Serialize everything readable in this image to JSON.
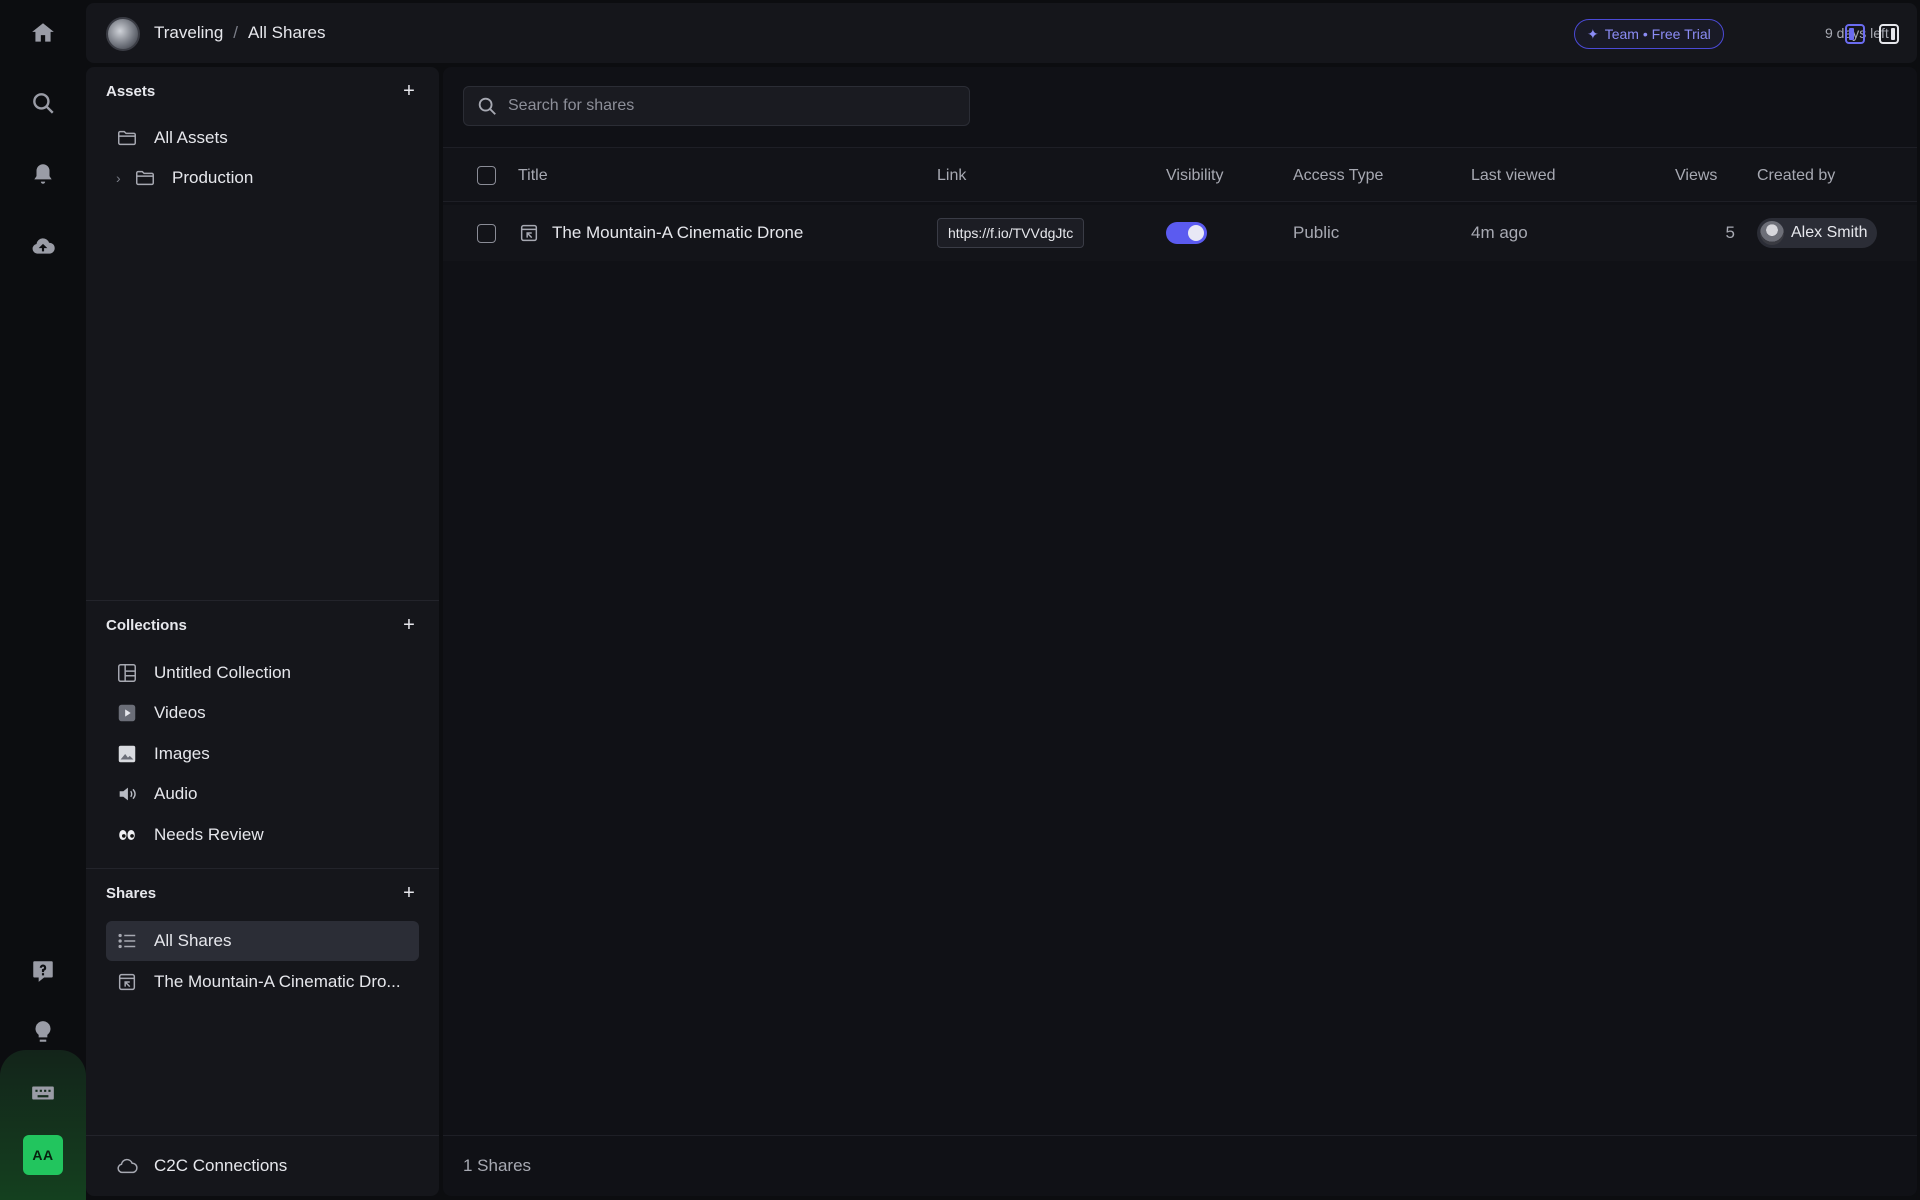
{
  "breadcrumbs": [
    "Traveling",
    "All Shares"
  ],
  "breadcrumb_separator": "/",
  "trial": {
    "label": "Team • Free Trial",
    "days_left": "9 days left"
  },
  "rail": {
    "avatar_initials": "AA",
    "icons": [
      "home-icon",
      "search-icon",
      "bell-icon",
      "upload-cloud-icon",
      "help-icon",
      "lightbulb-icon",
      "keyboard-icon"
    ]
  },
  "assets": {
    "title": "Assets",
    "items": [
      {
        "label": "All Assets",
        "icon": "folder-icon"
      },
      {
        "label": "Production",
        "icon": "folder-icon",
        "expandable": true
      }
    ]
  },
  "collections": {
    "title": "Collections",
    "items": [
      {
        "label": "Untitled Collection",
        "icon": "layout-grid-icon"
      },
      {
        "label": "Videos",
        "icon": "play-icon"
      },
      {
        "label": "Images",
        "icon": "image-icon"
      },
      {
        "label": "Audio",
        "icon": "speaker-icon"
      },
      {
        "label": "Needs Review",
        "icon": "eyes-icon"
      }
    ]
  },
  "shares": {
    "title": "Shares",
    "items": [
      {
        "label": "All Shares",
        "icon": "list-icon",
        "active": true
      },
      {
        "label": "The Mountain-A Cinematic Dro...",
        "icon": "share-icon"
      }
    ]
  },
  "c2c": {
    "label": "C2C Connections"
  },
  "main": {
    "search_placeholder": "Search for shares",
    "columns": [
      "Title",
      "Link",
      "Visibility",
      "Access Type",
      "Last viewed",
      "Views",
      "Created by"
    ],
    "rows": [
      {
        "title": "The Mountain-A Cinematic Drone",
        "link": "https://f.io/TVVdgJtc",
        "visibility_on": true,
        "access_type": "Public",
        "last_viewed": "4m ago",
        "views": "5",
        "created_by": "Alex Smith"
      }
    ],
    "footer": "1 Shares"
  },
  "colors": {
    "accent": "#5b5bf0",
    "avatar_green": "#22c55e",
    "bg": "#0c0d10"
  }
}
